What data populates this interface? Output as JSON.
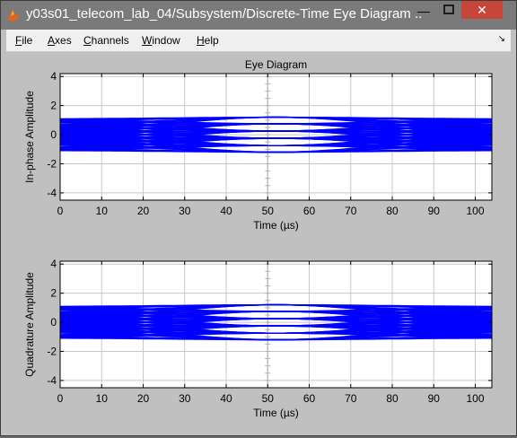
{
  "window": {
    "title": "y03s01_telecom_lab_04/Subsystem/Discrete-Time Eye Diagram ...",
    "min_glyph": "—",
    "close_glyph": "✕"
  },
  "menu": {
    "items": [
      "File",
      "Axes",
      "Channels",
      "Window",
      "Help"
    ],
    "dock_glyph": "↘"
  },
  "colors": {
    "trace": "#0000ff",
    "plot_bg": "#ffffff",
    "figure_bg": "#c0c0c0",
    "grid": "#c8c8c8"
  },
  "chart_data": [
    {
      "type": "line",
      "title": "Eye Diagram",
      "xlabel": "Time (µs)",
      "ylabel": "In-phase Amplitude",
      "xlim": [
        0,
        104
      ],
      "ylim": [
        -4.5,
        4.2
      ],
      "xticks": [
        0,
        10,
        20,
        30,
        40,
        50,
        60,
        70,
        80,
        90,
        100
      ],
      "yticks": [
        4,
        2,
        0,
        -2,
        -4
      ],
      "grid": true,
      "color": "#0000ff",
      "eye": {
        "center_levels": [
          1.2,
          0.75,
          0.25,
          -0.25,
          -0.75,
          -1.2
        ],
        "edge_levels": [
          1.0,
          0.6,
          0.2,
          -0.2,
          -0.6,
          -1.0
        ]
      }
    },
    {
      "type": "line",
      "title": "",
      "xlabel": "Time (µs)",
      "ylabel": "Quadrature Amplitude",
      "xlim": [
        0,
        104
      ],
      "ylim": [
        -4.5,
        4.2
      ],
      "xticks": [
        0,
        10,
        20,
        30,
        40,
        50,
        60,
        70,
        80,
        90,
        100
      ],
      "yticks": [
        4,
        2,
        0,
        -2,
        -4
      ],
      "grid": true,
      "color": "#0000ff",
      "eye": {
        "center_levels": [
          1.2,
          0.75,
          0.25,
          -0.25,
          -0.75,
          -1.2
        ],
        "edge_levels": [
          1.0,
          0.6,
          0.2,
          -0.2,
          -0.6,
          -1.0
        ]
      }
    }
  ]
}
